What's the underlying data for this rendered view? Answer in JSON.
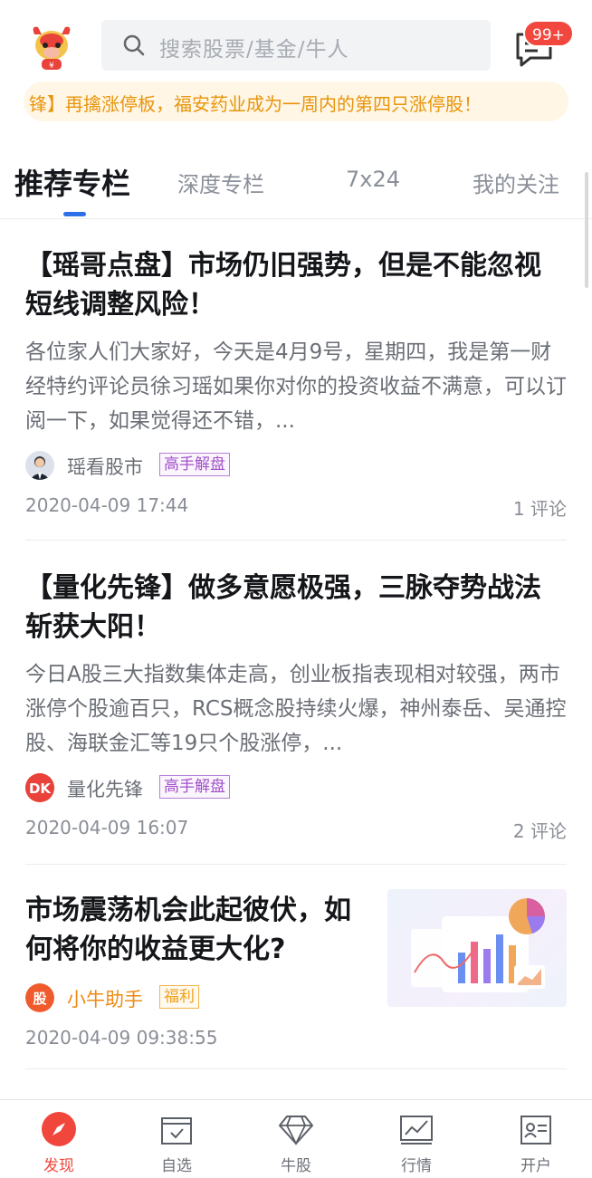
{
  "header": {
    "logo_icon": "bull-mascot-icon",
    "search_placeholder": "搜索股票/基金/牛人",
    "message_icon": "message-icon",
    "message_badge": "99+"
  },
  "ticker": {
    "text": "锋】再擒涨停板，福安药业成为一周内的第四只涨停股！"
  },
  "tabs": [
    {
      "label": "推荐专栏",
      "active": true
    },
    {
      "label": "深度专栏",
      "active": false
    },
    {
      "label": "7x24",
      "active": false
    },
    {
      "label": "我的关注",
      "active": false
    }
  ],
  "articles": [
    {
      "title": "【瑶哥点盘】市场仍旧强势，但是不能忽视短线调整风险！",
      "summary": "各位家人们大家好，今天是4月9号，星期四，我是第一财经特约评论员徐习瑶如果你对你的投资收益不满意，可以订阅一下，如果觉得还不错，...",
      "author": "瑶看股市",
      "tag": "高手解盘",
      "date": "2020-04-09 17:44",
      "comments": "1 评论"
    },
    {
      "title": "【量化先锋】做多意愿极强，三脉夺势战法斩获大阳！",
      "summary": "今日A股三大指数集体走高，创业板指表现相对较强，两市涨停个股逾百只，RCS概念股持续火爆，神州泰岳、吴通控股、海联金汇等19只个股涨停，...",
      "author": "量化先锋",
      "avatar_text": "DK",
      "tag": "高手解盘",
      "date": "2020-04-09 16:07",
      "comments": "2 评论"
    },
    {
      "title": "市场震荡机会此起彼伏，如何将你的收益更大化?",
      "author": "小牛助手",
      "avatar_text": "股",
      "tag": "福利",
      "date": "2020-04-09 09:38:55"
    }
  ],
  "bottom_nav": [
    {
      "label": "发现",
      "icon": "compass-icon",
      "active": true
    },
    {
      "label": "自选",
      "icon": "checkbox-icon",
      "active": false
    },
    {
      "label": "牛股",
      "icon": "diamond-icon",
      "active": false
    },
    {
      "label": "行情",
      "icon": "chart-icon",
      "active": false
    },
    {
      "label": "开户",
      "icon": "id-card-icon",
      "active": false
    }
  ],
  "colors": {
    "accent_blue": "#2e6ee8",
    "active_red": "#f0463c",
    "ticker_orange": "#e8950c",
    "tag_purple": "#a150c9",
    "tag_orange": "#f0a018"
  }
}
